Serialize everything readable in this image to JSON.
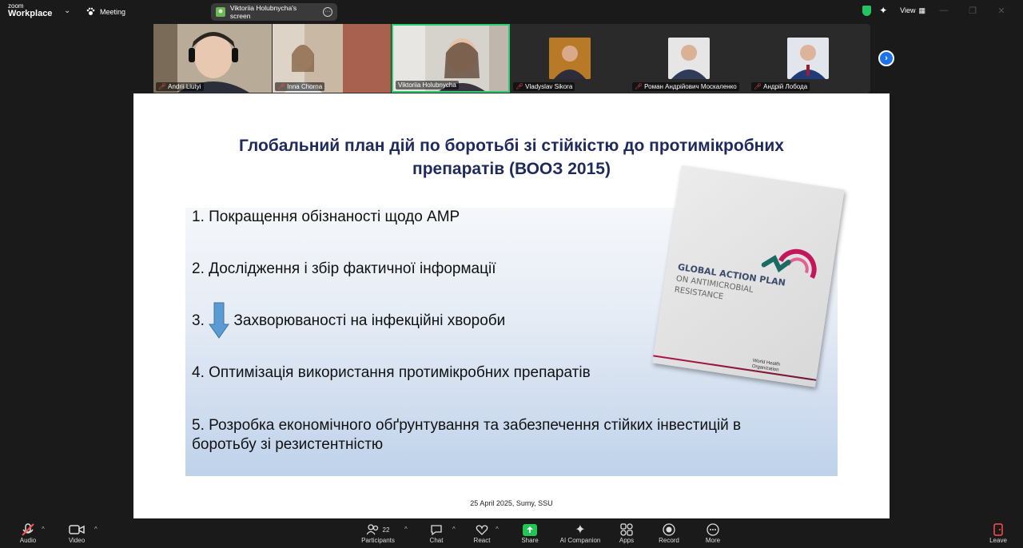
{
  "app": {
    "logo_line1": "zoom",
    "logo_line2": "Workplace",
    "meeting_label": "Meeting",
    "share_label": "Viktoriia Holubnycha's screen",
    "view_label": "View"
  },
  "participants": [
    {
      "name": "Andrii Liutyi",
      "muted": true,
      "active": false
    },
    {
      "name": "Inna Chorna",
      "muted": true,
      "active": false
    },
    {
      "name": "Viktoriia Holubnycha",
      "muted": false,
      "active": true
    },
    {
      "name": "Vladyslav Sikora",
      "muted": true,
      "active": false
    },
    {
      "name": "Роман Андрійович Москаленко",
      "muted": true,
      "active": false
    },
    {
      "name": "Андрій Лобода",
      "muted": true,
      "active": false
    }
  ],
  "slide": {
    "title_line1": "Глобальний план дій по боротьбі зі стійкістю до протимікробних",
    "title_line2": "препаратів (ВООЗ 2015)",
    "item1": "1.   Покращення обізнаності щодо АМР",
    "item2": "2. Дослідження і збір фактичної інформації",
    "item3_num": "3.",
    "item3_text": "Захворюваності на інфекційні хвороби",
    "item4": "4. Оптимізація використання протимікробних препаратів",
    "item5_line1": "5. Розробка економічного обґрунтування та забезпечення стійких інвестицій в",
    "item5_line2": "боротьбу зі резистентністю",
    "footer": "25 April 2025,  Sumy, SSU",
    "book_title": "GLOBAL ACTION PLAN",
    "book_sub1": "ON ANTIMICROBIAL",
    "book_sub2": "RESISTANCE",
    "book_org1": "World Health",
    "book_org2": "Organization"
  },
  "toolbar": {
    "audio": "Audio",
    "video": "Video",
    "participants": "Participants",
    "participants_count": "22",
    "chat": "Chat",
    "react": "React",
    "share": "Share",
    "ai": "AI Companion",
    "apps": "Apps",
    "record": "Record",
    "more": "More",
    "leave": "Leave"
  },
  "colors": {
    "accent": "#2ecc71",
    "title": "#1f2a5c",
    "share_green": "#23c552",
    "mute_red": "#ff4d4d"
  }
}
